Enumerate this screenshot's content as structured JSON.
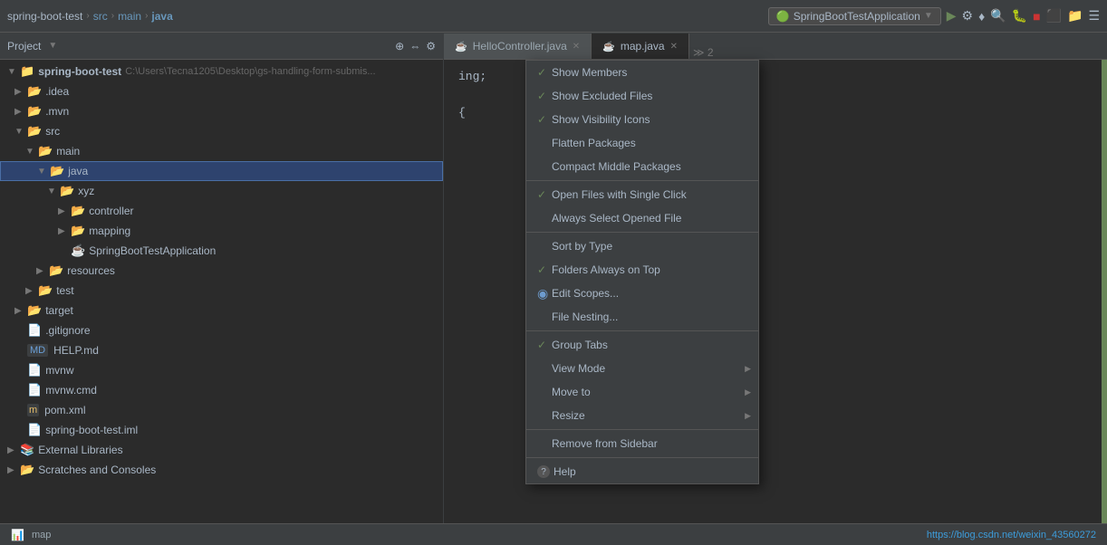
{
  "toolbar": {
    "breadcrumb": [
      {
        "label": "spring-boot-test",
        "type": "project"
      },
      {
        "label": "src",
        "type": "folder"
      },
      {
        "label": "main",
        "type": "folder"
      },
      {
        "label": "java",
        "type": "folder-current"
      }
    ],
    "run_config": {
      "icon": "▶",
      "label": "SpringBootTestApplication"
    },
    "icons": [
      "↺",
      "⚙",
      "♦",
      "🔍",
      "☕",
      "☕",
      "🐛",
      "■",
      "⬛",
      "📁",
      "☰"
    ]
  },
  "sidebar": {
    "title": "Project",
    "tree": [
      {
        "id": "spring-boot-test",
        "label": "spring-boot-test",
        "path": "C:\\Users\\Tecna1205\\Desktop\\gs-handling-form-submis...",
        "indent": 0,
        "type": "project",
        "expanded": true,
        "arrow": "▼"
      },
      {
        "id": "idea",
        "label": ".idea",
        "indent": 1,
        "type": "folder",
        "expanded": false,
        "arrow": "▶"
      },
      {
        "id": "mvn",
        "label": ".mvn",
        "indent": 1,
        "type": "folder",
        "expanded": false,
        "arrow": "▶"
      },
      {
        "id": "src",
        "label": "src",
        "indent": 1,
        "type": "folder",
        "expanded": true,
        "arrow": "▼"
      },
      {
        "id": "main",
        "label": "main",
        "indent": 2,
        "type": "folder",
        "expanded": true,
        "arrow": "▼"
      },
      {
        "id": "java",
        "label": "java",
        "indent": 3,
        "type": "folder-open",
        "expanded": true,
        "arrow": "▼",
        "selected": true
      },
      {
        "id": "xyz",
        "label": "xyz",
        "indent": 4,
        "type": "folder",
        "expanded": true,
        "arrow": "▼"
      },
      {
        "id": "controller",
        "label": "controller",
        "indent": 5,
        "type": "folder",
        "expanded": false,
        "arrow": "▶"
      },
      {
        "id": "mapping",
        "label": "mapping",
        "indent": 5,
        "type": "folder",
        "expanded": false,
        "arrow": "▶"
      },
      {
        "id": "SpringBootTestApplication",
        "label": "SpringBootTestApplication",
        "indent": 5,
        "type": "java",
        "arrow": ""
      },
      {
        "id": "resources",
        "label": "resources",
        "indent": 3,
        "type": "folder",
        "expanded": false,
        "arrow": "▶"
      },
      {
        "id": "test",
        "label": "test",
        "indent": 2,
        "type": "folder",
        "expanded": false,
        "arrow": "▶"
      },
      {
        "id": "target",
        "label": "target",
        "indent": 1,
        "type": "folder-open",
        "expanded": false,
        "arrow": "▶"
      },
      {
        "id": "gitignore",
        "label": ".gitignore",
        "indent": 1,
        "type": "file",
        "arrow": ""
      },
      {
        "id": "HELP",
        "label": "HELP.md",
        "indent": 1,
        "type": "md",
        "arrow": ""
      },
      {
        "id": "mvnw",
        "label": "mvnw",
        "indent": 1,
        "type": "file",
        "arrow": ""
      },
      {
        "id": "mvnw-cmd",
        "label": "mvnw.cmd",
        "indent": 1,
        "type": "file",
        "arrow": ""
      },
      {
        "id": "pom",
        "label": "pom.xml",
        "indent": 1,
        "type": "xml",
        "arrow": ""
      },
      {
        "id": "iml",
        "label": "spring-boot-test.iml",
        "indent": 1,
        "type": "iml",
        "arrow": ""
      },
      {
        "id": "ext-libs",
        "label": "External Libraries",
        "indent": 0,
        "type": "folder",
        "expanded": false,
        "arrow": "▶"
      },
      {
        "id": "scratches",
        "label": "Scratches and Consoles",
        "indent": 0,
        "type": "folder",
        "expanded": false,
        "arrow": "▶"
      }
    ]
  },
  "tabs": [
    {
      "label": "HelloController.java",
      "active": false
    },
    {
      "label": "map.java",
      "active": true
    }
  ],
  "editor": {
    "lines": [
      {
        "text": "ing;",
        "indent": 0
      },
      {
        "text": "",
        "indent": 0
      },
      {
        "text": "{",
        "indent": 0
      }
    ]
  },
  "dropdown": {
    "items": [
      {
        "type": "check",
        "checked": true,
        "label": "Show Members"
      },
      {
        "type": "check",
        "checked": true,
        "label": "Show Excluded Files"
      },
      {
        "type": "check",
        "checked": true,
        "label": "Show Visibility Icons"
      },
      {
        "type": "plain",
        "checked": false,
        "label": "Flatten Packages"
      },
      {
        "type": "plain",
        "checked": false,
        "label": "Compact Middle Packages"
      },
      {
        "type": "divider"
      },
      {
        "type": "check",
        "checked": true,
        "label": "Open Files with Single Click"
      },
      {
        "type": "plain",
        "checked": false,
        "label": "Always Select Opened File"
      },
      {
        "type": "divider"
      },
      {
        "type": "plain",
        "checked": false,
        "label": "Sort by Type"
      },
      {
        "type": "check",
        "checked": true,
        "label": "Folders Always on Top"
      },
      {
        "type": "radio",
        "checked": true,
        "label": "Edit Scopes..."
      },
      {
        "type": "plain",
        "checked": false,
        "label": "File Nesting..."
      },
      {
        "type": "divider"
      },
      {
        "type": "check",
        "checked": true,
        "label": "Group Tabs"
      },
      {
        "type": "submenu",
        "label": "View Mode"
      },
      {
        "type": "submenu",
        "label": "Move to"
      },
      {
        "type": "submenu",
        "label": "Resize"
      },
      {
        "type": "divider"
      },
      {
        "type": "plain",
        "label": "Remove from Sidebar"
      },
      {
        "type": "divider"
      },
      {
        "type": "help",
        "label": "Help"
      }
    ]
  },
  "status_bar": {
    "left": "map",
    "right": "https://blog.csdn.net/weixin_43560272"
  }
}
